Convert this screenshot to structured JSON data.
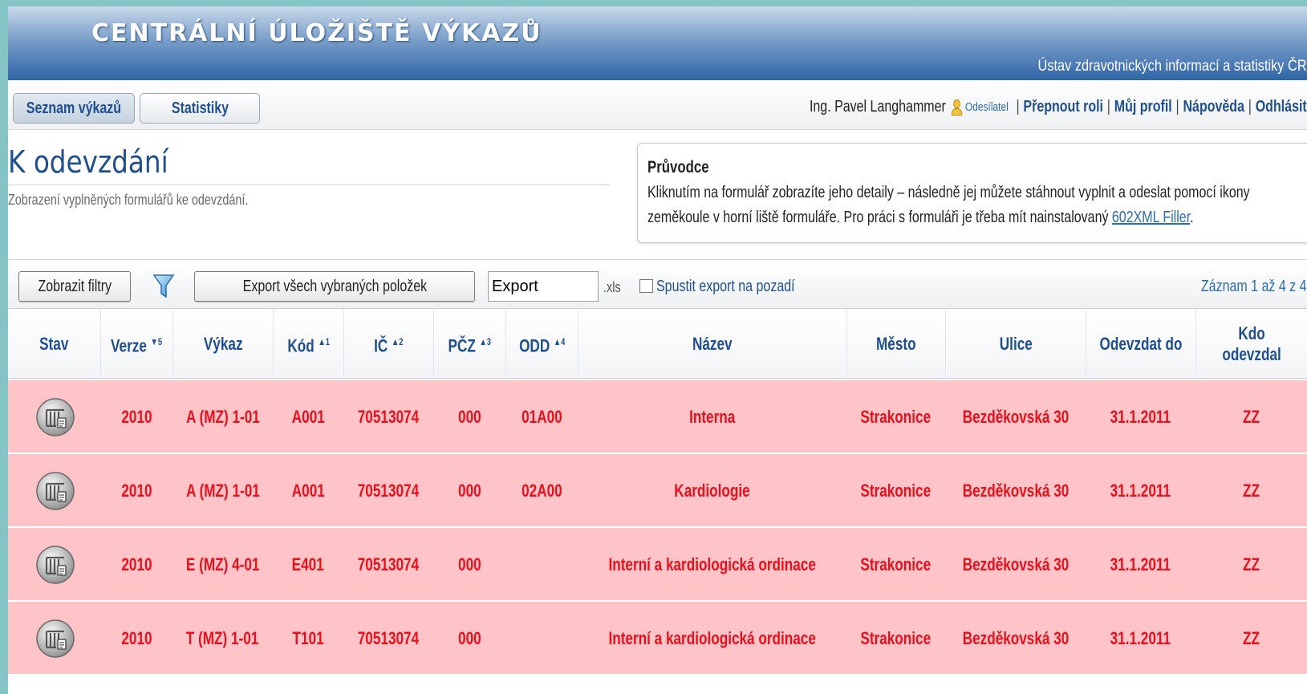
{
  "header": {
    "title": "CENTRÁLNÍ ÚLOŽIŠTĚ VÝKAZŮ",
    "organization": "Ústav zdravotnických informací a statistiky ČR"
  },
  "nav": {
    "tabs": [
      {
        "label": "Seznam výkazů"
      },
      {
        "label": "Statistiky"
      }
    ]
  },
  "user": {
    "name": "Ing. Pavel Langhammer",
    "role": "Odesílatel",
    "links": [
      "Přepnout roli",
      "Můj profil",
      "Nápověda",
      "Odhlásit"
    ]
  },
  "page": {
    "title": "K odevzdání",
    "subtitle": "Zobrazení vyplněných formulářů ke odevzdání."
  },
  "guide": {
    "title": "Průvodce",
    "text_line1": "Kliknutím na formulář zobrazíte jeho detaily – následně jej můžete stáhnout vyplnit a odeslat pomocí ikony",
    "text_line2_prefix": "zeměkoule v horní liště formuláře. Pro práci s formuláři je třeba mít nainstalovaný ",
    "link": "602XML Filler",
    "text_line2_suffix": "."
  },
  "toolbar": {
    "show_filters": "Zobrazit filtry",
    "export_all": "Export všech vybraných položek",
    "export_filename": "Export",
    "extension": ".xls",
    "background_export": "Spustit export na pozadí",
    "record_count": "Záznam 1 až 4 z 4"
  },
  "table": {
    "columns": [
      {
        "label": "Stav",
        "sort": ""
      },
      {
        "label": "Verze",
        "sort": "▼5"
      },
      {
        "label": "Výkaz",
        "sort": ""
      },
      {
        "label": "Kód",
        "sort": "▲1"
      },
      {
        "label": "IČ",
        "sort": "▲2"
      },
      {
        "label": "PČZ",
        "sort": "▲3"
      },
      {
        "label": "ODD",
        "sort": "▲4"
      },
      {
        "label": "Název",
        "sort": ""
      },
      {
        "label": "Město",
        "sort": ""
      },
      {
        "label": "Ulice",
        "sort": ""
      },
      {
        "label": "Odevzdat do",
        "sort": ""
      },
      {
        "label": "Kdo odevzdal",
        "sort": ""
      }
    ],
    "rows": [
      {
        "verze": "2010",
        "vykaz": "A (MZ) 1-01",
        "kod": "A001",
        "ic": "70513074",
        "pcz": "000",
        "odd": "01A00",
        "nazev": "Interna",
        "mesto": "Strakonice",
        "ulice": "Bezděkovská 30",
        "odevzdat": "31.1.2011",
        "kdo": "ZZ"
      },
      {
        "verze": "2010",
        "vykaz": "A (MZ) 1-01",
        "kod": "A001",
        "ic": "70513074",
        "pcz": "000",
        "odd": "02A00",
        "nazev": "Kardiologie",
        "mesto": "Strakonice",
        "ulice": "Bezděkovská 30",
        "odevzdat": "31.1.2011",
        "kdo": "ZZ"
      },
      {
        "verze": "2010",
        "vykaz": "E (MZ) 4-01",
        "kod": "E401",
        "ic": "70513074",
        "pcz": "000",
        "odd": "",
        "nazev": "Interní a kardiologická ordinace",
        "mesto": "Strakonice",
        "ulice": "Bezděkovská 30",
        "odevzdat": "31.1.2011",
        "kdo": "ZZ"
      },
      {
        "verze": "2010",
        "vykaz": "T (MZ) 1-01",
        "kod": "T101",
        "ic": "70513074",
        "pcz": "000",
        "odd": "",
        "nazev": "Interní a kardiologická ordinace",
        "mesto": "Strakonice",
        "ulice": "Bezděkovská 30",
        "odevzdat": "31.1.2011",
        "kdo": "ZZ"
      }
    ]
  }
}
